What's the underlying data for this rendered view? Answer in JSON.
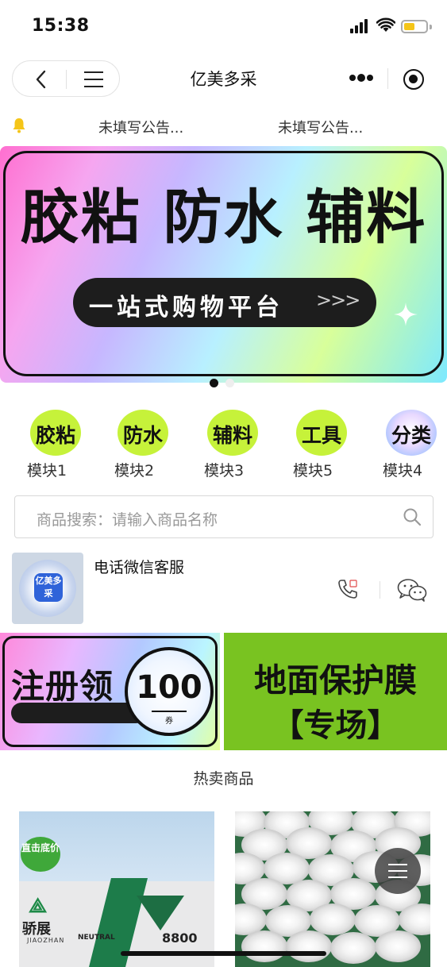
{
  "status_bar": {
    "time": "15:38"
  },
  "nav": {
    "title": "亿美多采"
  },
  "notice": {
    "items": [
      "未填写公告...",
      "未填写公告..."
    ]
  },
  "banner": {
    "title": "胶粘 防水 辅料",
    "subtitle": "一站式购物平台",
    "arrows": ">>>",
    "slide_count": 2,
    "active_slide": 1
  },
  "categories": [
    {
      "badge": "胶粘",
      "label": "模块1"
    },
    {
      "badge": "防水",
      "label": "模块2"
    },
    {
      "badge": "辅料",
      "label": "模块3"
    },
    {
      "badge": "工具",
      "label": "模块5"
    },
    {
      "badge": "分类",
      "label": "模块4"
    }
  ],
  "search": {
    "placeholder": "商品搜索：请输入商品名称"
  },
  "service": {
    "title": "电话微信客服",
    "qr_logo_text": "亿美多采"
  },
  "promos": {
    "left": {
      "text": "注册领",
      "coupon_value": "100",
      "coupon_unit": "券"
    },
    "right": {
      "title": "地面保护膜",
      "subtitle": "【专场】"
    }
  },
  "hot": {
    "title": "热卖商品",
    "products": [
      {
        "badge": "直击底价",
        "brand": "骄展",
        "brand_en": "JIAOZHAN",
        "variant": "NEUTRAL",
        "code": "8800"
      },
      {
        "name": ""
      }
    ]
  },
  "colors": {
    "accent_green": "#c6f23a",
    "promo_green": "#79c321",
    "bell": "#f5c518"
  }
}
